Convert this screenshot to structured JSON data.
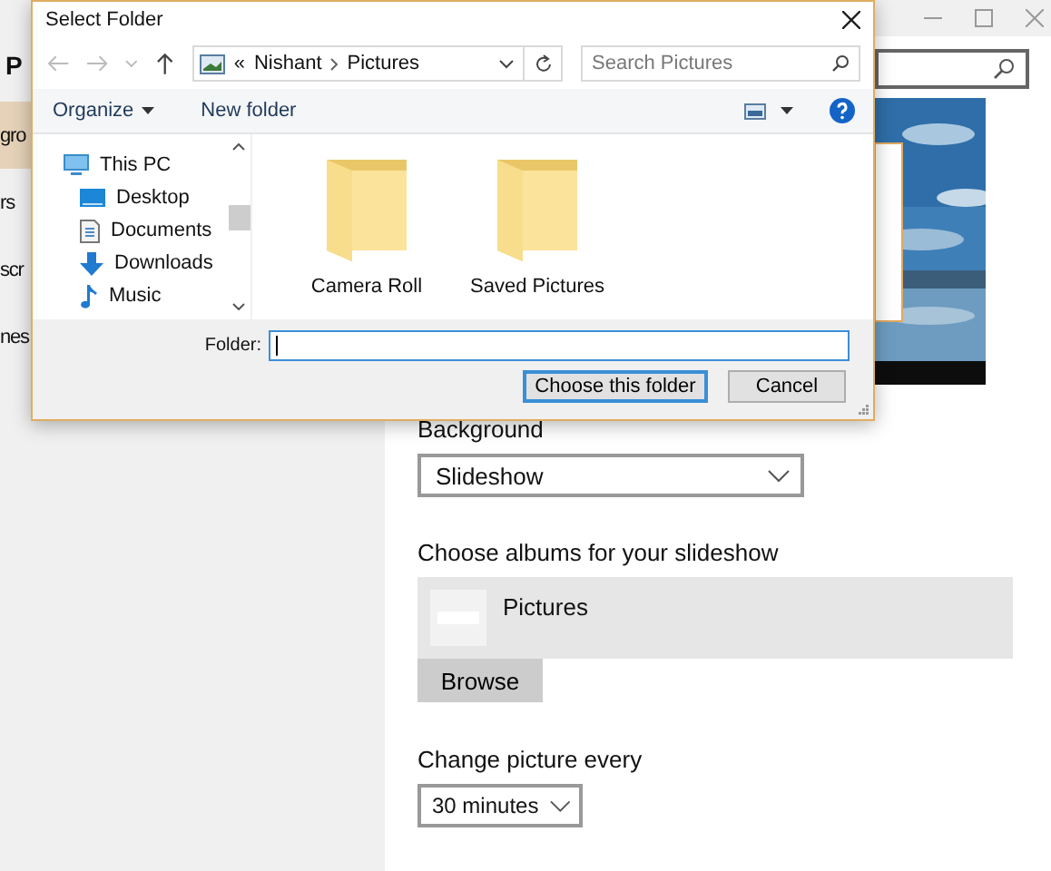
{
  "settings_window": {
    "sidebar": {
      "heading": "P",
      "items": [
        {
          "label": "gro",
          "selected": true
        },
        {
          "label": "rs",
          "selected": false
        },
        {
          "label": "scr",
          "selected": false
        },
        {
          "label": "nes",
          "selected": false
        }
      ]
    },
    "background": {
      "label": "Background",
      "value": "Slideshow"
    },
    "albums": {
      "label": "Choose albums for your slideshow",
      "items": [
        {
          "name": "Pictures"
        }
      ],
      "browse_button": "Browse"
    },
    "interval": {
      "label": "Change picture every",
      "value": "30 minutes"
    }
  },
  "dialog": {
    "title": "Select Folder",
    "overflow_mark": "«",
    "breadcrumb": [
      "Nishant",
      "Pictures"
    ],
    "search": {
      "placeholder": "Search Pictures"
    },
    "toolbar": [
      "Organize",
      "New folder"
    ],
    "nav_items": [
      {
        "label": "This PC",
        "kind": "pc"
      },
      {
        "label": "Desktop",
        "kind": "desktop"
      },
      {
        "label": "Documents",
        "kind": "documents"
      },
      {
        "label": "Downloads",
        "kind": "downloads"
      },
      {
        "label": "Music",
        "kind": "music"
      }
    ],
    "folders": [
      {
        "name": "Camera Roll"
      },
      {
        "name": "Saved Pictures"
      }
    ],
    "folder_label": "Folder:",
    "buttons": [
      {
        "label": "Choose this folder",
        "default": true
      },
      {
        "label": "Cancel",
        "default": false
      }
    ]
  }
}
